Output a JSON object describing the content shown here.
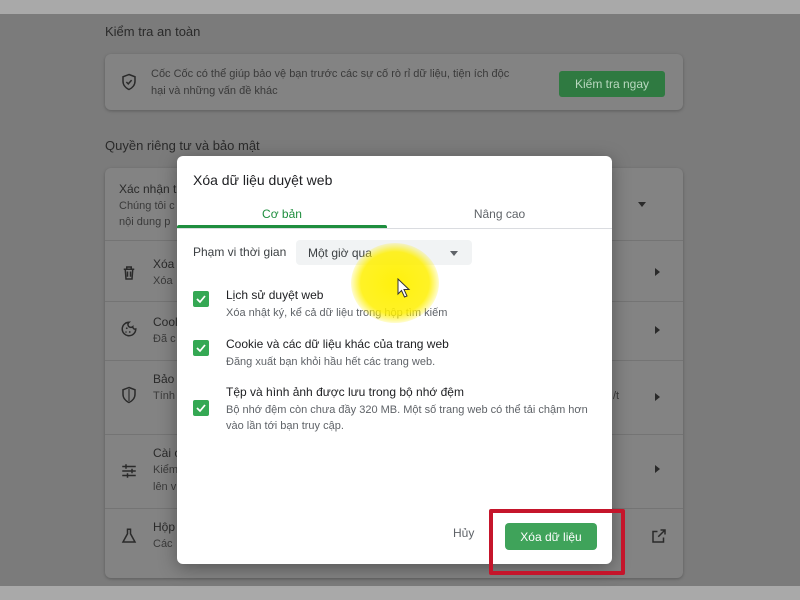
{
  "background": {
    "safety_check": {
      "title": "Kiểm tra an toàn",
      "text_line1": "Cốc Cốc có thể giúp bảo vệ bạn trước các sự cố rò rỉ dữ liệu, tiện ích độc",
      "text_line2": "hại và những vấn đề khác",
      "button_label": "Kiểm tra ngay"
    },
    "privacy": {
      "title": "Quyền riêng tư và bảo mật",
      "rows": [
        {
          "title": "Xác nhận t",
          "sub1": "Chúng tôi c",
          "sub2": "nội dung p"
        },
        {
          "title": "Xóa",
          "sub1": "Xóa"
        },
        {
          "title": "Cool",
          "sub1": "Đã c"
        },
        {
          "title": "Bảo",
          "sub1": "Tính",
          "sub2": "/t"
        },
        {
          "title": "Cài c",
          "sub1": "Kiểm",
          "sub2": "lên v"
        },
        {
          "title": "Hộp",
          "sub1": "Các"
        }
      ]
    }
  },
  "dialog": {
    "title": "Xóa dữ liệu duyệt web",
    "tabs": [
      {
        "label": "Cơ bản",
        "active": true
      },
      {
        "label": "Nâng cao",
        "active": false
      }
    ],
    "time_range": {
      "label": "Phạm vi thời gian",
      "value": "Một giờ qua"
    },
    "options": [
      {
        "title": "Lịch sử duyệt web",
        "description": "Xóa nhật ký, kể cả dữ liệu trong hộp tìm kiếm",
        "checked": true
      },
      {
        "title": "Cookie và các dữ liệu khác của trang web",
        "description": "Đăng xuất bạn khỏi hầu hết các trang web.",
        "checked": true
      },
      {
        "title": "Tệp và hình ảnh được lưu trong bộ nhớ đệm",
        "description": "Bộ nhớ đệm còn chưa đầy 320 MB. Một số trang web có thể tải chậm hơn vào lần tới bạn truy cập.",
        "checked": true
      }
    ],
    "cancel_label": "Hủy",
    "confirm_label": "Xóa dữ liệu"
  },
  "colors": {
    "accent_green": "#1e8e3e",
    "button_green": "#3fa35a",
    "highlight_red": "#c5152b",
    "cursor_yellow": "#fff000"
  }
}
